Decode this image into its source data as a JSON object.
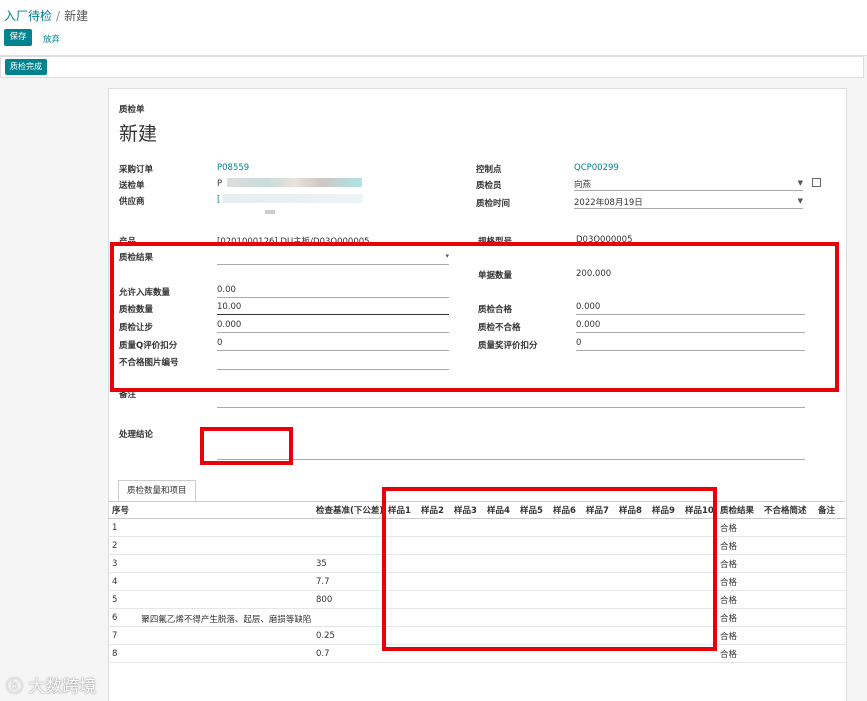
{
  "breadcrumb": {
    "parent": "入厂待检",
    "current": "新建"
  },
  "toolbar": {
    "save": "保存",
    "discard": "放弃"
  },
  "status": {
    "done": "质检完成"
  },
  "form": {
    "type": "质检单",
    "title": "新建",
    "left": {
      "po_label": "采购订单",
      "po_value": "P08559",
      "delivery_label": "送检单",
      "delivery_value": "P",
      "supplier_label": "供应商",
      "supplier_value": "[",
      "product_label": "产品",
      "product_value": "[0201000126] DU主板/D03O000005"
    },
    "right": {
      "control_label": "控制点",
      "control_value": "QCP00299",
      "inspector_label": "质检员",
      "inspector_value": "向燕",
      "time_label": "质检时间",
      "time_value": "2022年08月19日",
      "spec_label": "规格型号",
      "spec_value": "D03O000005",
      "qty_label": "单据数量",
      "qty_value": "200.000",
      "pass_label": "质检合格",
      "pass_value": "0.000",
      "fail_label": "质检不合格",
      "fail_value": "0.000",
      "quality_label": "质量奖评价扣分",
      "quality_value": "0"
    },
    "result_label": "质检结果",
    "allow_label": "允许入库数量",
    "allow_value": "0.00",
    "inspect_qty_label": "质检数量",
    "inspect_qty_value": "10.00",
    "step_label": "质检让步",
    "step_value": "0.000",
    "qscore_label": "质量Q评价扣分",
    "qscore_value": "0",
    "photo_label": "不合格图片编号",
    "remark_label": "备注",
    "conclusion_label": "处理结论"
  },
  "tab": {
    "label": "质检数量和项目"
  },
  "table": {
    "headers": [
      "序号",
      "检查基准(下公差)",
      "样品1",
      "样品2",
      "样品3",
      "样品4",
      "样品5",
      "样品6",
      "样品7",
      "样品8",
      "样品9",
      "样品10",
      "质检结果",
      "不合格简述",
      "备注"
    ],
    "rows": [
      {
        "seq": "1",
        "base": "",
        "result": "合格"
      },
      {
        "seq": "2",
        "base": "",
        "result": "合格"
      },
      {
        "seq": "3",
        "base": "35",
        "result": "合格"
      },
      {
        "seq": "4",
        "base": "7.7",
        "result": "合格"
      },
      {
        "seq": "5",
        "base": "800",
        "result": "合格"
      },
      {
        "seq": "6",
        "base": "聚四氟乙烯不得产生脱落、起层、磨损等缺陷",
        "result": "合格"
      },
      {
        "seq": "7",
        "base": "0.25",
        "result": "合格"
      },
      {
        "seq": "8",
        "base": "0.7",
        "result": "合格"
      }
    ]
  },
  "watermark": "大数跨境",
  "colors": {
    "accent": "#00838f",
    "highlight": "#e8000b"
  }
}
